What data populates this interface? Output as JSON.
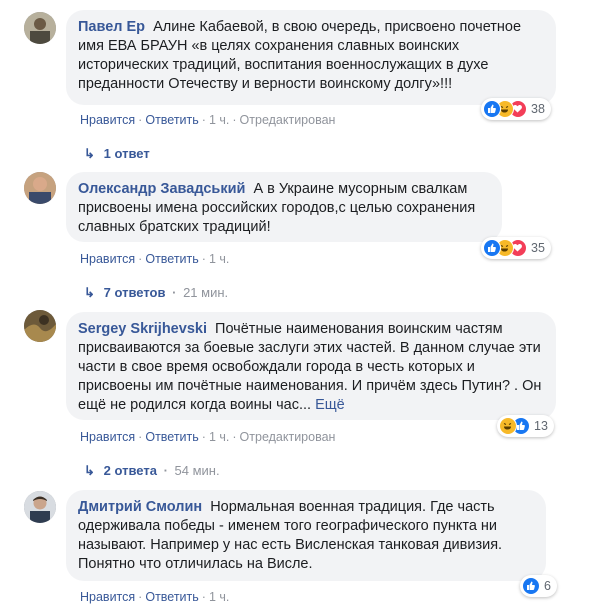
{
  "comments": [
    {
      "author": "Павел Ер",
      "text": "Алине Кабаевой, в свою очередь, присвоено почетное имя ЕВА БРАУН «в целях сохранения славных воинских исторических традиций, воспитания военнослужащих в духе преданности Отечеству и верности воинскому долгу»!!!",
      "like": "Нравится",
      "reply": "Ответить",
      "time": "1 ч.",
      "edited": "Отредактирован",
      "reaction_count": "38",
      "reactions": [
        "like-icon",
        "haha-icon",
        "love-icon"
      ],
      "replies": {
        "label": "1 ответ",
        "meta": ""
      }
    },
    {
      "author": "Олександр Завадський",
      "text": "А в Украине мусорным свалкам присвоены имена российских городов,с целью сохранения славных братских традиций!",
      "like": "Нравится",
      "reply": "Ответить",
      "time": "1 ч.",
      "edited": "",
      "reaction_count": "35",
      "reactions": [
        "like-icon",
        "haha-icon",
        "love-icon"
      ],
      "replies": {
        "label": "7 ответов",
        "meta": "21 мин."
      }
    },
    {
      "author": "Sergey Skrijhevski",
      "text": "Почётные наименования воинским частям присваиваются за боевые заслуги этих частей. В данном случае эти части в свое время освобождали города в честь которых и присвоены им почётные наименования. И причём здесь Путин? . Он ещё не родился когда воины час...",
      "more": "Ещё",
      "like": "Нравится",
      "reply": "Ответить",
      "time": "1 ч.",
      "edited": "Отредактирован",
      "reaction_count": "13",
      "reactions": [
        "haha-icon",
        "like-icon"
      ],
      "replies": {
        "label": "2 ответа",
        "meta": "54 мин."
      }
    },
    {
      "author": "Дмитрий Смолин",
      "text": "Нормальная военная традиция. Где часть одерживала победы - именем того географического пункта ни называют. Например у нас есть Висленская танковая дивизия. Понятно что отличилась на Висле.",
      "like": "Нравится",
      "reply": "Ответить",
      "time": "1 ч.",
      "edited": "",
      "reaction_count": "6",
      "reactions": [
        "like-icon"
      ]
    }
  ],
  "sep": "·",
  "reply_arrow": "↳",
  "colors": {
    "link": "#385898",
    "bubble": "#f2f3f5",
    "like": "#1877f2",
    "haha": "#f7b928",
    "love": "#f33e58"
  }
}
